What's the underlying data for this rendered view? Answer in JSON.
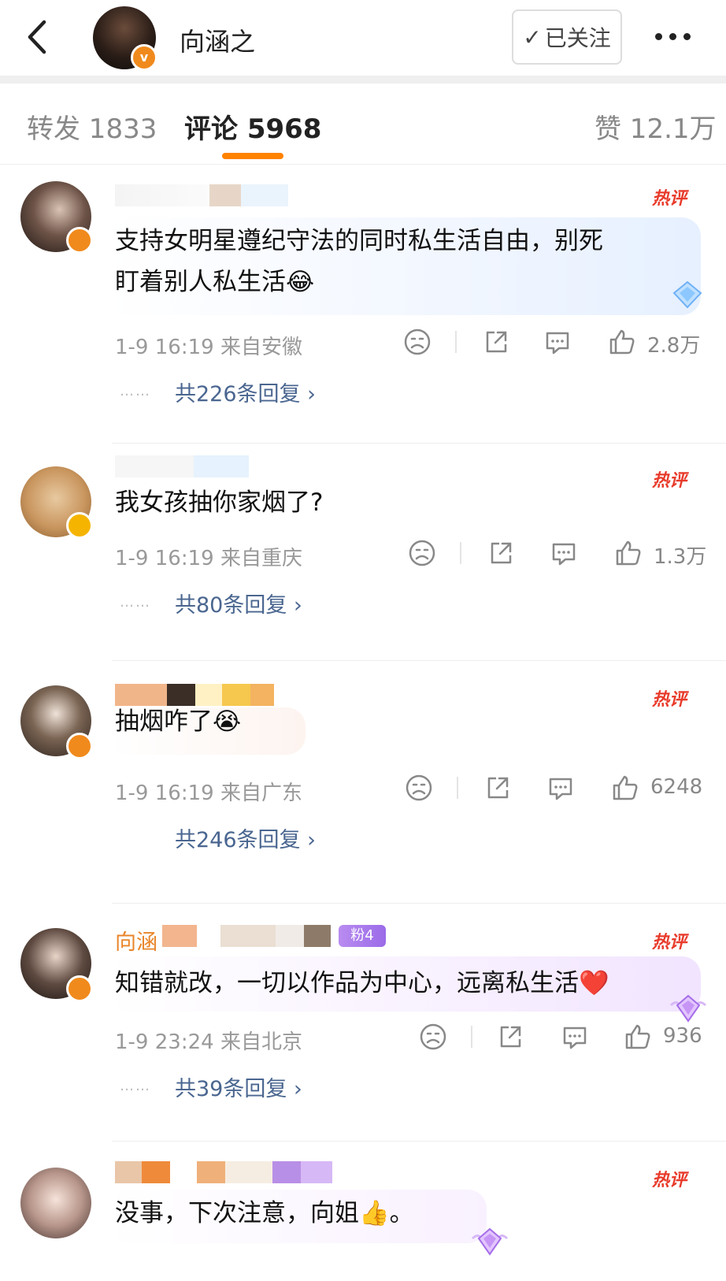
{
  "header": {
    "username": "向涵之",
    "badge": "v",
    "follow_label": "已关注",
    "follow_check": "✓"
  },
  "tabs": {
    "repost": "转发 1833",
    "comments": "评论 5968",
    "likes": "赞 12.1万"
  },
  "hot_label": "热评",
  "comments": [
    {
      "text_line1": "支持女明星遵纪守法的同时私生活自由，别死",
      "text_line2": "盯着别人私生活😂",
      "time": "1-9 16:19",
      "location": "来自安徽",
      "likes": "2.8万",
      "replies": "共226条回复",
      "chevron": "›",
      "dots": "……"
    },
    {
      "text_line1": "我女孩抽你家烟了?",
      "time": "1-9 16:19",
      "location": "来自重庆",
      "likes": "1.3万",
      "replies": "共80条回复",
      "chevron": "›",
      "dots": "……"
    },
    {
      "text_line1": "抽烟咋了😭",
      "time": "1-9 16:19",
      "location": "来自广东",
      "likes": "6248",
      "replies": "共246条回复",
      "chevron": "›",
      "dots": "……"
    },
    {
      "name_visible": "向涵",
      "fan_tag": "粉4",
      "text_line1": "知错就改，一切以作品为中心，远离私生活❤️",
      "time": "1-9 23:24",
      "location": "来自北京",
      "likes": "936",
      "replies": "共39条回复",
      "chevron": "›",
      "dots": "……"
    },
    {
      "text_line1": "没事，下次注意，向姐👍。"
    }
  ],
  "colors": {
    "accent": "#ff8200",
    "reply_link": "#4a6690",
    "hot": "#e83b2b",
    "badge_orange": "#f08a1c",
    "badge_gold": "#f5b400"
  },
  "icons": [
    "back-arrow-icon",
    "more-icon",
    "dislike-face-icon",
    "share-icon",
    "comment-icon",
    "like-thumb-icon",
    "diamond-icon"
  ]
}
